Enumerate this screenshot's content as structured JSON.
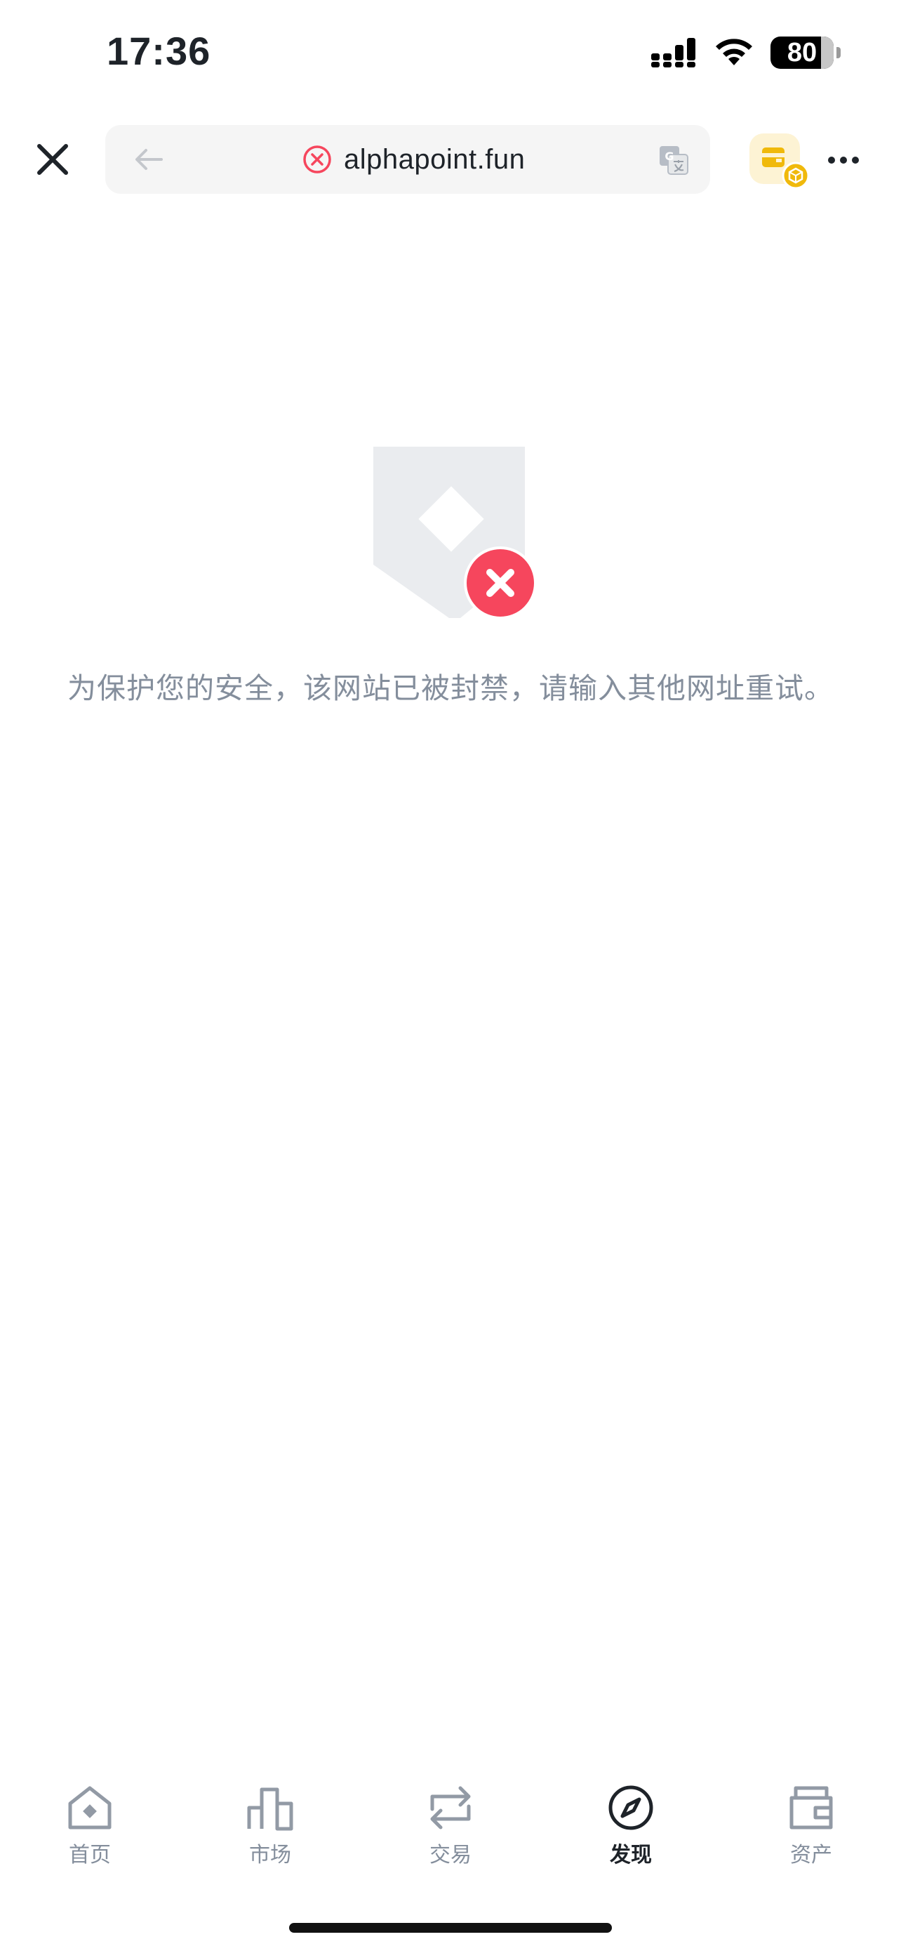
{
  "status_bar": {
    "time": "17:36",
    "battery": "80",
    "icons": [
      "cellular-signal-icon",
      "wifi-icon",
      "battery-icon"
    ]
  },
  "browser": {
    "url": "alphapoint.fun",
    "url_status": "blocked",
    "icons": [
      "close-icon",
      "back-arrow-icon",
      "blocked-site-icon",
      "translate-icon",
      "mini-app-icon",
      "more-icon"
    ]
  },
  "blocked_page": {
    "message": "为保护您的安全，该网站已被封禁，请输入其他网址重试。",
    "icon": "blocked-page-illustration"
  },
  "tab_bar": {
    "items": [
      {
        "label": "首页",
        "icon": "home-icon",
        "active": false
      },
      {
        "label": "市场",
        "icon": "markets-icon",
        "active": false
      },
      {
        "label": "交易",
        "icon": "trade-icon",
        "active": false
      },
      {
        "label": "发现",
        "icon": "discover-compass-icon",
        "active": true
      },
      {
        "label": "资产",
        "icon": "wallet-icon",
        "active": false
      }
    ]
  },
  "colors": {
    "accent_danger": "#f6465d",
    "accent_brand": "#f0b90b",
    "text_primary": "#1e2329",
    "text_secondary": "#848e9c"
  }
}
